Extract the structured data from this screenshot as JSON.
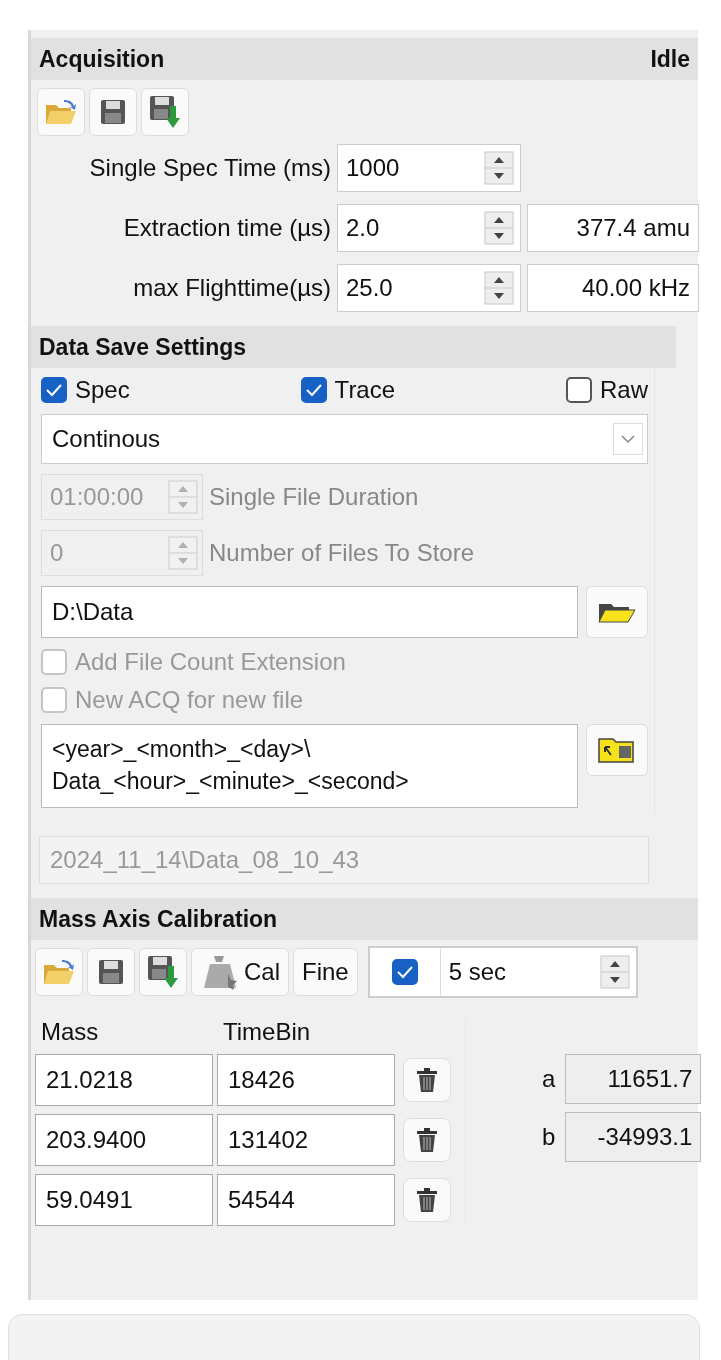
{
  "acquisition": {
    "title": "Acquisition",
    "status": "Idle",
    "toolbar": [
      {
        "kind": "open"
      },
      {
        "kind": "save"
      },
      {
        "kind": "save_as"
      }
    ],
    "fields": [
      {
        "label": "Single Spec Time (ms)",
        "value": "1000"
      },
      {
        "label": "Extraction time (µs)",
        "value": "2.0",
        "readout": "377.4 amu"
      },
      {
        "label": "max Flighttime(µs)",
        "value": "25.0",
        "readout": "40.00 kHz"
      }
    ]
  },
  "data_save": {
    "title": "Data Save Settings",
    "checkboxes": [
      {
        "label": "Spec",
        "checked": true
      },
      {
        "label": "Trace",
        "checked": true
      },
      {
        "label": "Raw",
        "checked": false
      }
    ],
    "mode": "Continous",
    "spin_rows": [
      {
        "value": "01:00:00",
        "label": "Single File Duration",
        "disabled": true
      },
      {
        "value": "0",
        "label": "Number of Files To Store",
        "disabled": true
      }
    ],
    "path": "D:\\Data",
    "options": [
      {
        "label": "Add File Count Extension",
        "checked": false,
        "disabled": true
      },
      {
        "label": "New ACQ for new file",
        "checked": false,
        "disabled": true
      }
    ],
    "template_lines": [
      "<year>_<month>_<day>\\",
      "Data_<hour>_<minute>_<second>"
    ],
    "preview": {
      "value": "2024_11_14\\Data_08_10_43",
      "disabled": true
    }
  },
  "calibration": {
    "title": "Mass Axis Calibration",
    "toolbar": [
      {
        "kind": "open"
      },
      {
        "kind": "save"
      },
      {
        "kind": "save_as"
      }
    ],
    "cal_button": "Cal",
    "fine_button": "Fine",
    "auto": {
      "checked": true,
      "value": "5 sec"
    },
    "columns": [
      "Mass",
      "TimeBin"
    ],
    "rows": [
      {
        "mass": "21.0218",
        "time_bin": "18426"
      },
      {
        "mass": "203.9400",
        "time_bin": "131402"
      },
      {
        "mass": "59.0491",
        "time_bin": "54544"
      }
    ],
    "coefficients": [
      {
        "name": "a",
        "value": "11651.7"
      },
      {
        "name": "b",
        "value": "-34993.1"
      }
    ]
  }
}
